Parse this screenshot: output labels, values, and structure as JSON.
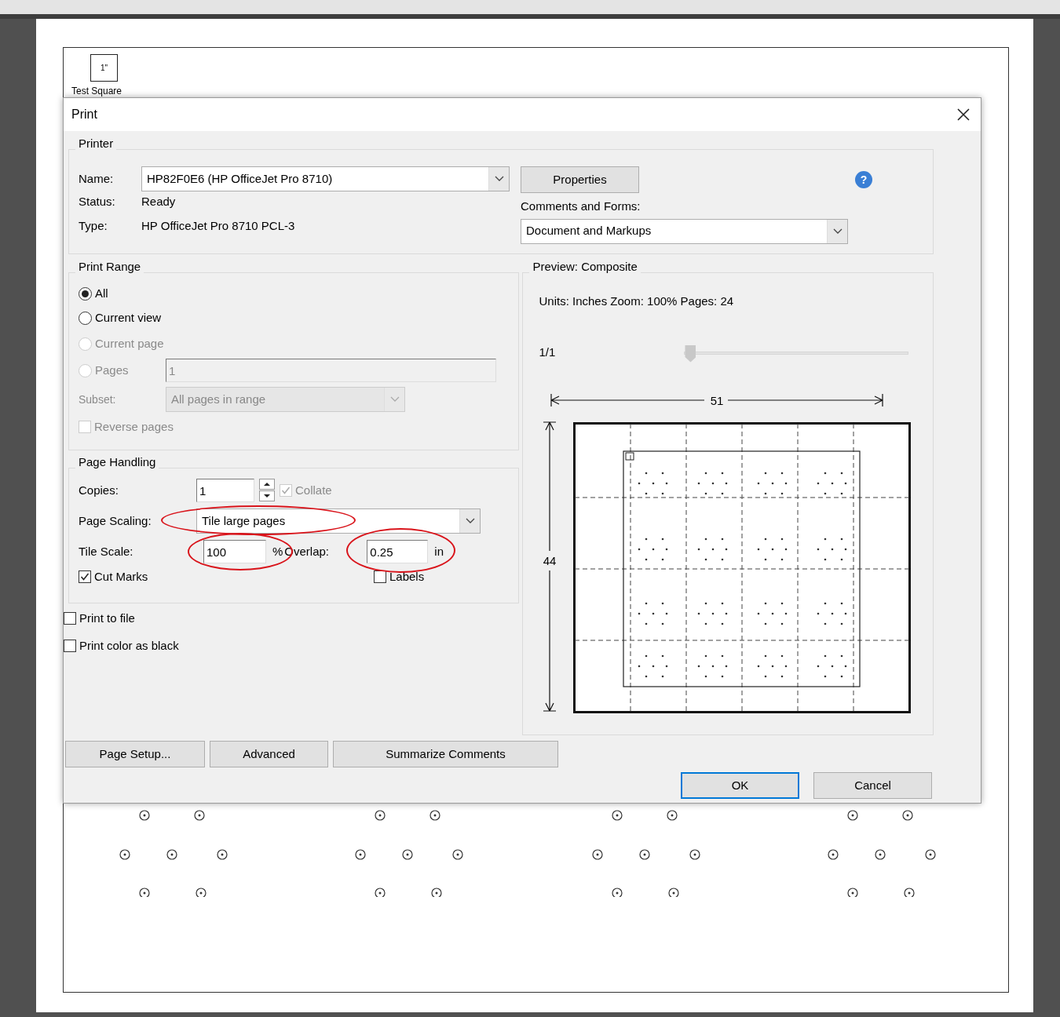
{
  "document": {
    "test_square_label": "1\"",
    "test_square_caption": "Test Square"
  },
  "dialog": {
    "title": "Print"
  },
  "printer": {
    "legend": "Printer",
    "name_label": "Name:",
    "name_value": "HP82F0E6 (HP OfficeJet Pro 8710)",
    "status_label": "Status:",
    "status_value": "Ready",
    "type_label": "Type:",
    "type_value": "HP OfficeJet Pro 8710 PCL-3",
    "properties_button": "Properties",
    "help_symbol": "?",
    "comments_label": "Comments and Forms:",
    "comments_value": "Document and Markups"
  },
  "print_range": {
    "legend": "Print Range",
    "options": [
      {
        "label": "All",
        "selected": true,
        "disabled": false
      },
      {
        "label": "Current view",
        "selected": false,
        "disabled": false
      },
      {
        "label": "Current page",
        "selected": false,
        "disabled": true
      },
      {
        "label": "Pages",
        "selected": false,
        "disabled": true
      }
    ],
    "pages_value": "1",
    "pages_disabled": true,
    "subset_label": "Subset:",
    "subset_value": "All pages in range",
    "subset_disabled": true,
    "reverse_pages": {
      "label": "Reverse pages",
      "checked": false,
      "disabled": true
    }
  },
  "page_handling": {
    "legend": "Page Handling",
    "copies_label": "Copies:",
    "copies_value": "1",
    "collate": {
      "label": "Collate",
      "checked": true,
      "disabled": true
    },
    "scaling_label": "Page Scaling:",
    "scaling_value": "Tile large pages",
    "tile_scale_label": "Tile Scale:",
    "tile_scale_value": "100",
    "tile_scale_unit": "%",
    "overlap_label": "Overlap:",
    "overlap_value": "0.25",
    "overlap_unit": "in",
    "cut_marks": {
      "label": "Cut Marks",
      "checked": true,
      "disabled": false
    },
    "labels": {
      "label": "Labels",
      "checked": false,
      "disabled": false
    }
  },
  "options": [
    {
      "label": "Print to file",
      "checked": false,
      "disabled": false
    },
    {
      "label": "Print color as black",
      "checked": false,
      "disabled": false
    }
  ],
  "preview": {
    "legend": "Preview: Composite",
    "info": "Units: Inches Zoom: 100% Pages: 24",
    "page_indicator": "1/1",
    "slider": {
      "level": 0
    },
    "width_label": "51",
    "height_label": "44"
  },
  "buttons": [
    {
      "label": "Page Setup..."
    },
    {
      "label": "Advanced"
    },
    {
      "label": "Summarize Comments"
    }
  ],
  "footer_buttons": [
    {
      "label": "OK",
      "focused": true
    },
    {
      "label": "Cancel",
      "focused": false
    }
  ]
}
